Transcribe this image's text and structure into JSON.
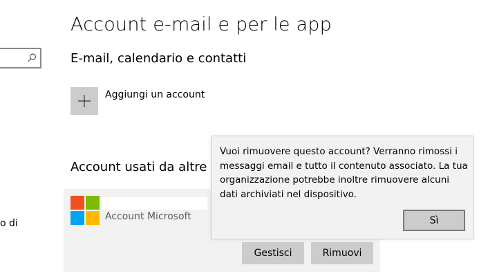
{
  "left_pane": {
    "search_placeholder": "",
    "cropped_item_text": "o di"
  },
  "main": {
    "title": "Account e-mail e per le app",
    "email_section_title": "E-mail, calendario e contatti",
    "add_account_label": "Aggiungi un account",
    "other_apps_section_title": "Account usati da altre a"
  },
  "account": {
    "email": "",
    "type": "Account Microsoft",
    "manage_label": "Gestisci",
    "remove_label": "Rimuovi"
  },
  "flyout": {
    "message": "Vuoi rimuovere questo account? Verranno rimossi i messaggi email e tutto il contenuto associato. La tua organizzazione potrebbe inoltre rimuovere alcuni dati archiviati nel dispositivo.",
    "confirm_label": "Sì"
  },
  "colors": {
    "tile_gray": "#cccccc",
    "card_bg": "#f2f2f2",
    "ms_red": "#f25022",
    "ms_green": "#7fba00",
    "ms_blue": "#00a4ef",
    "ms_yellow": "#ffb900"
  }
}
